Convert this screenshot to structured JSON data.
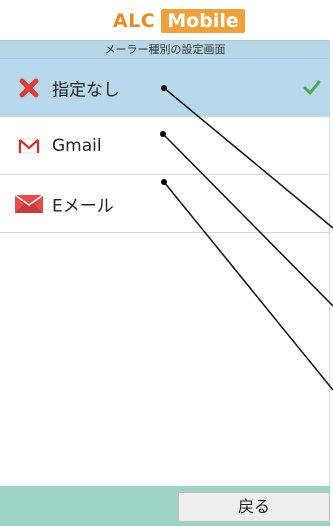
{
  "header": {
    "logo_part1": "ALC",
    "logo_part2": "Mobile",
    "subtitle": "メーラー種別の設定画面"
  },
  "mailer_list": {
    "items": [
      {
        "label": "指定なし",
        "icon": "red-x-icon",
        "selected": true
      },
      {
        "label": "Gmail",
        "icon": "gmail-icon",
        "selected": false
      },
      {
        "label": "Eメール",
        "icon": "email-envelope-icon",
        "selected": false
      }
    ],
    "selected_mark_icon": "checkmark-icon"
  },
  "footer": {
    "back_label": "戻る"
  },
  "colors": {
    "logo_orange": "#e98a1c",
    "subtitle_bar": "#b6d7e7",
    "selected_row": "#b8d8eb",
    "bottom_bar": "#9ed3c6",
    "check_green": "#4caf50"
  }
}
